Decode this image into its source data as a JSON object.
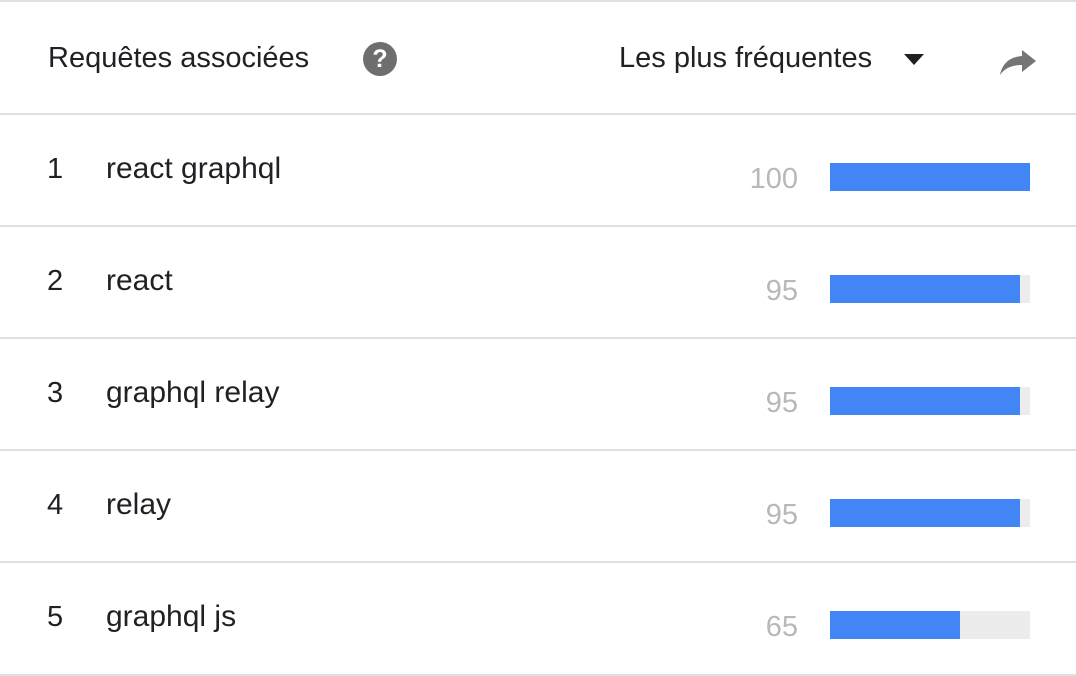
{
  "header": {
    "title": "Requêtes associées",
    "help_icon": "help-circle-icon",
    "help_glyph": "?",
    "sort_label": "Les plus fréquentes",
    "sort_caret_icon": "caret-down-icon",
    "share_icon": "share-icon"
  },
  "colors": {
    "bar_fill": "#4285f4",
    "bar_track": "#ececec",
    "value_text": "#b8b8b8"
  },
  "rows": [
    {
      "rank": "1",
      "query": "react graphql",
      "value": "100",
      "level": 100
    },
    {
      "rank": "2",
      "query": "react",
      "value": "95",
      "level": 95
    },
    {
      "rank": "3",
      "query": "graphql relay",
      "value": "95",
      "level": 95
    },
    {
      "rank": "4",
      "query": "relay",
      "value": "95",
      "level": 95
    },
    {
      "rank": "5",
      "query": "graphql js",
      "value": "65",
      "level": 65
    }
  ]
}
